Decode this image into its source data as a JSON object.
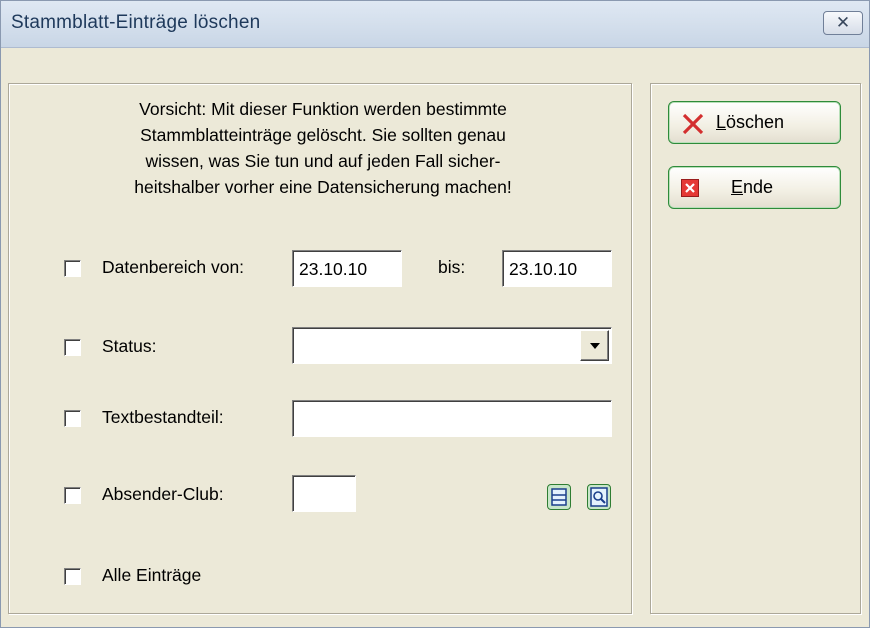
{
  "window": {
    "title": "Stammblatt-Einträge löschen",
    "close_icon": "close-icon"
  },
  "warning": {
    "lines": [
      "Vorsicht: Mit dieser Funktion werden bestimmte",
      "Stammblatteinträge gelöscht. Sie sollten genau",
      "wissen, was Sie tun und auf jeden Fall sicher-",
      "heitshalber vorher eine Datensicherung machen!"
    ]
  },
  "form": {
    "date_range": {
      "label": "Datenbereich von:",
      "from": "23.10.10",
      "to_label": "bis:",
      "to": "23.10.10",
      "checked": false
    },
    "status": {
      "label": "Status:",
      "value": "",
      "checked": false
    },
    "text_part": {
      "label": "Textbestandteil:",
      "value": "",
      "checked": false
    },
    "sender_club": {
      "label": "Absender-Club:",
      "value": "",
      "checked": false
    },
    "all_entries": {
      "label": "Alle Einträge",
      "checked": false
    }
  },
  "buttons": {
    "delete": {
      "mnemonic": "L",
      "rest": "öschen",
      "icon": "red-x-icon"
    },
    "end": {
      "mnemonic": "E",
      "rest": "nde",
      "icon": "close-box-icon"
    }
  },
  "colors": {
    "accent_green": "#2e8b3a",
    "delete_red": "#d32f2f",
    "background": "#ece9d8"
  }
}
